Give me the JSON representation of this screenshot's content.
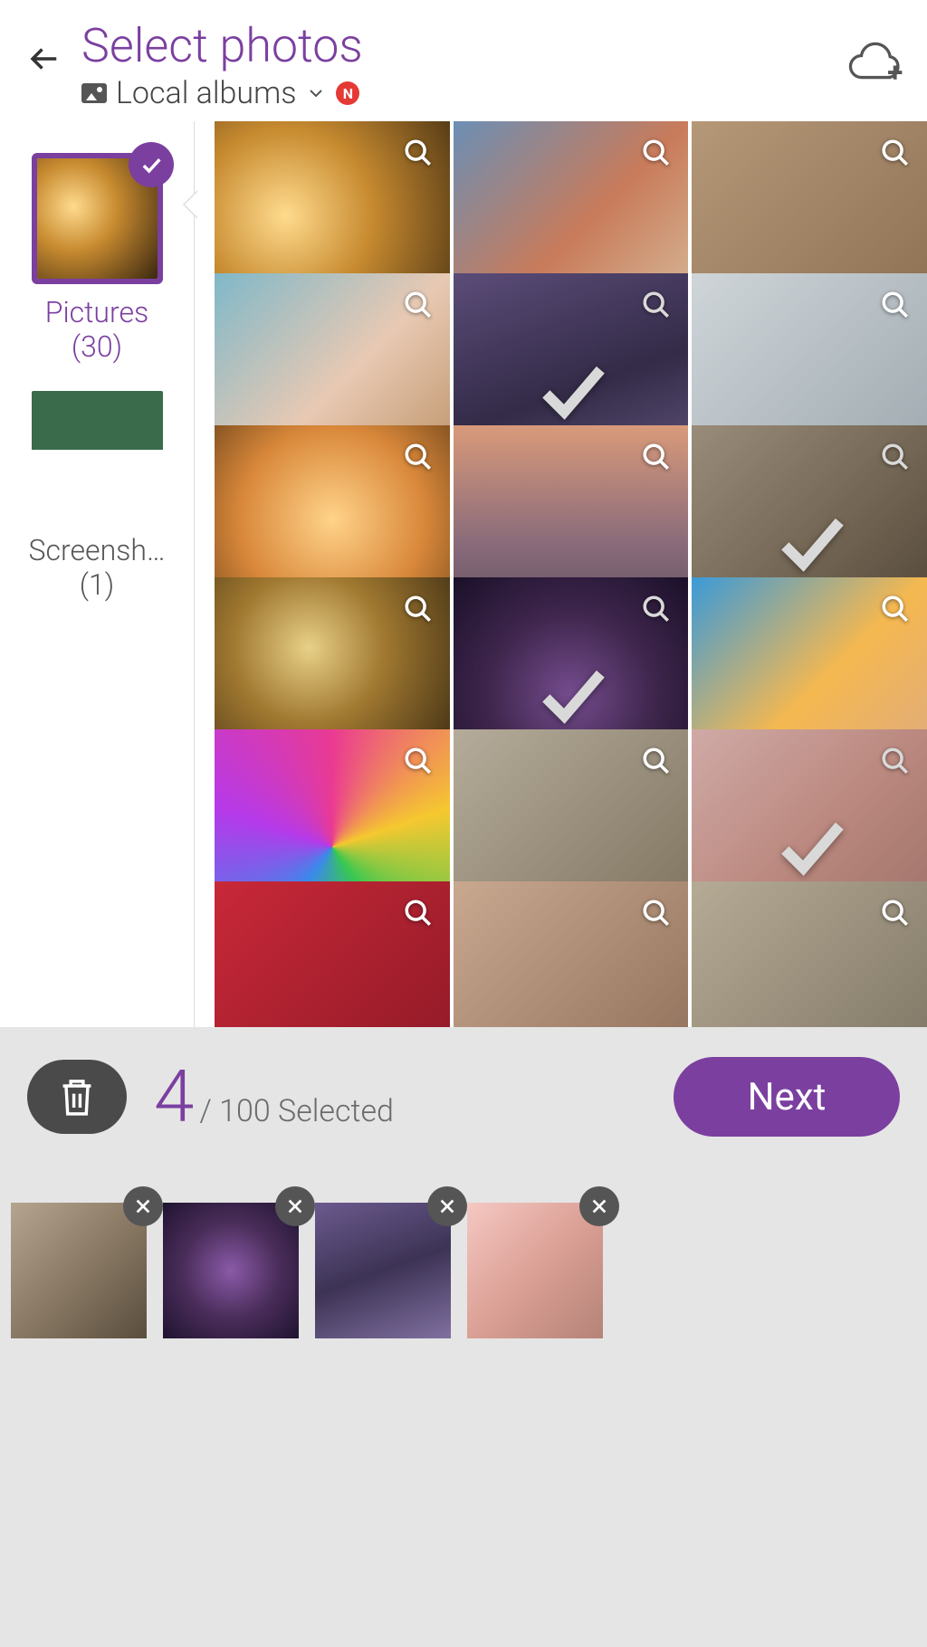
{
  "header": {
    "title": "Select photos",
    "source_label": "Local albums",
    "notification_badge": "N"
  },
  "sidebar": {
    "albums": [
      {
        "name": "Pictures",
        "count": "(30)",
        "selected": true,
        "thumbClass": "ph-sunset"
      },
      {
        "name": "Screensh…",
        "count": "(1)",
        "selected": false,
        "thumbClass": "ph-screenshot"
      }
    ]
  },
  "grid": {
    "photos": [
      {
        "cls": "ph-sunset",
        "selected": false
      },
      {
        "cls": "ph-couple1",
        "selected": false
      },
      {
        "cls": "ph-couple2",
        "selected": false
      },
      {
        "cls": "ph-lying",
        "selected": false
      },
      {
        "cls": "ph-hands",
        "selected": true
      },
      {
        "cls": "ph-arms",
        "selected": false
      },
      {
        "cls": "ph-kiss",
        "selected": false
      },
      {
        "cls": "ph-water",
        "selected": false
      },
      {
        "cls": "ph-walk",
        "selected": true
      },
      {
        "cls": "ph-glasses",
        "selected": false
      },
      {
        "cls": "ph-heart",
        "selected": true
      },
      {
        "cls": "ph-beach",
        "selected": false
      },
      {
        "cls": "ph-cupcakes",
        "selected": false
      },
      {
        "cls": "ph-city",
        "selected": false
      },
      {
        "cls": "ph-pinkcakes",
        "selected": true
      },
      {
        "cls": "ph-roses",
        "selected": false
      },
      {
        "cls": "ph-faces",
        "selected": false
      },
      {
        "cls": "ph-venice",
        "selected": false
      }
    ]
  },
  "footer": {
    "selected_count": "4",
    "selected_suffix": "/ 100 Selected",
    "next_label": "Next",
    "selected_items": [
      {
        "cls": "ph-walk"
      },
      {
        "cls": "ph-heart"
      },
      {
        "cls": "ph-hands"
      },
      {
        "cls": "ph-pinkcakes"
      }
    ]
  }
}
